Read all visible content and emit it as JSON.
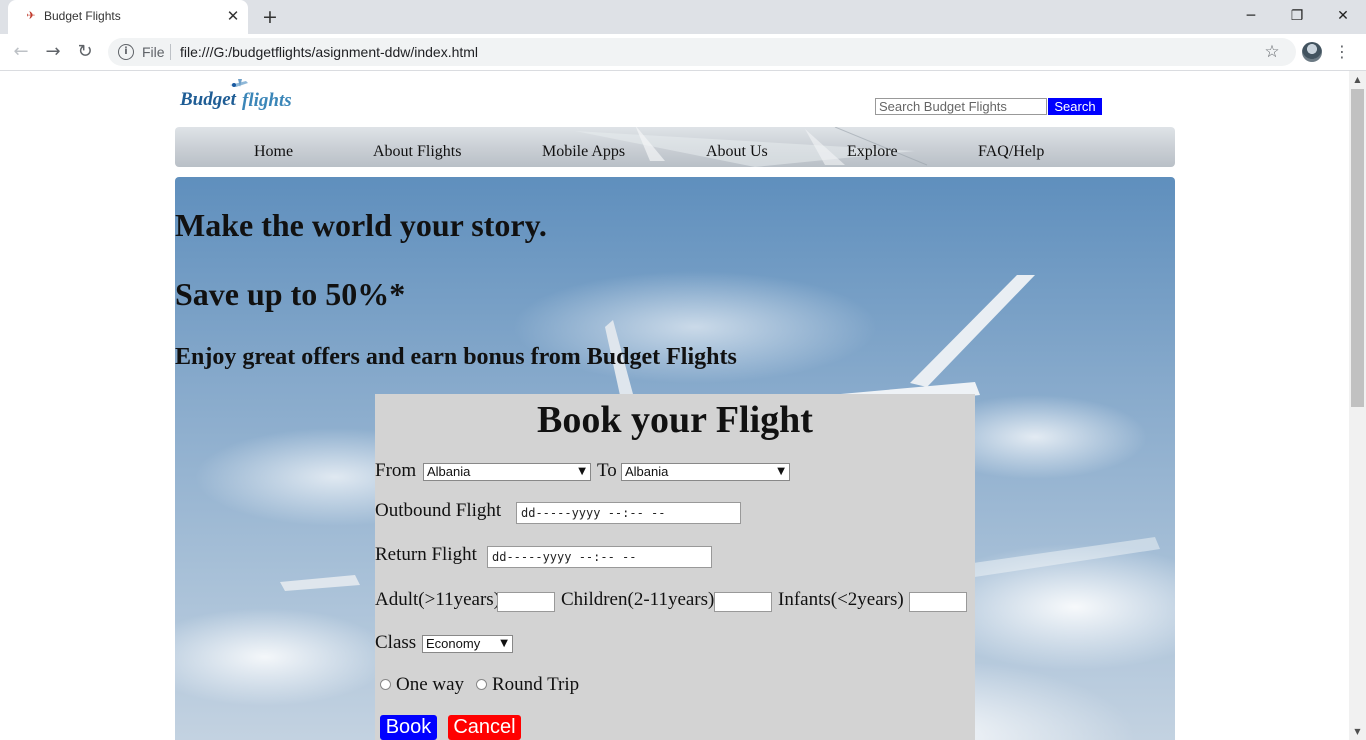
{
  "browser": {
    "tab_title": "Budget Flights",
    "tab_icon": "airplane-favicon-icon",
    "new_tab_icon": "plus-icon",
    "window_controls": {
      "minimize": "─",
      "restore": "❐",
      "close": "✕"
    },
    "file_label": "File",
    "url": "file:///G:/budgetflights/asignment-ddw/index.html"
  },
  "site": {
    "logo_text": "Budget flights",
    "search": {
      "placeholder": "Search Budget Flights",
      "button_label": "Search"
    },
    "nav": [
      "Home",
      "About Flights",
      "Mobile Apps",
      "About Us",
      "Explore",
      "FAQ/Help"
    ]
  },
  "hero": {
    "headline": "Make the world your story.",
    "offer": "Save up to 50%*",
    "tagline": "Enjoy great offers and earn bonus from Budget Flights"
  },
  "booking": {
    "title": "Book your Flight",
    "from_label": "From",
    "from_value": "Albania",
    "to_label": "To",
    "to_value": "Albania",
    "outbound_label": "Outbound Flight",
    "outbound_value": "dd-----yyyy --:-- --",
    "return_label": "Return Flight",
    "return_value": "dd-----yyyy --:-- --",
    "adult_label": "Adult(>11years)",
    "children_label": "Children(2-11years)",
    "infants_label": "Infants(<2years)",
    "class_label": "Class",
    "class_value": "Economy",
    "one_way_label": "One way",
    "round_trip_label": "Round Trip",
    "book_label": "Book",
    "cancel_label": "Cancel"
  },
  "colors": {
    "search_button": "#0000ff",
    "book_button": "#0000ff",
    "cancel_button": "#ff0000",
    "booking_panel": "#d3d3d3"
  }
}
